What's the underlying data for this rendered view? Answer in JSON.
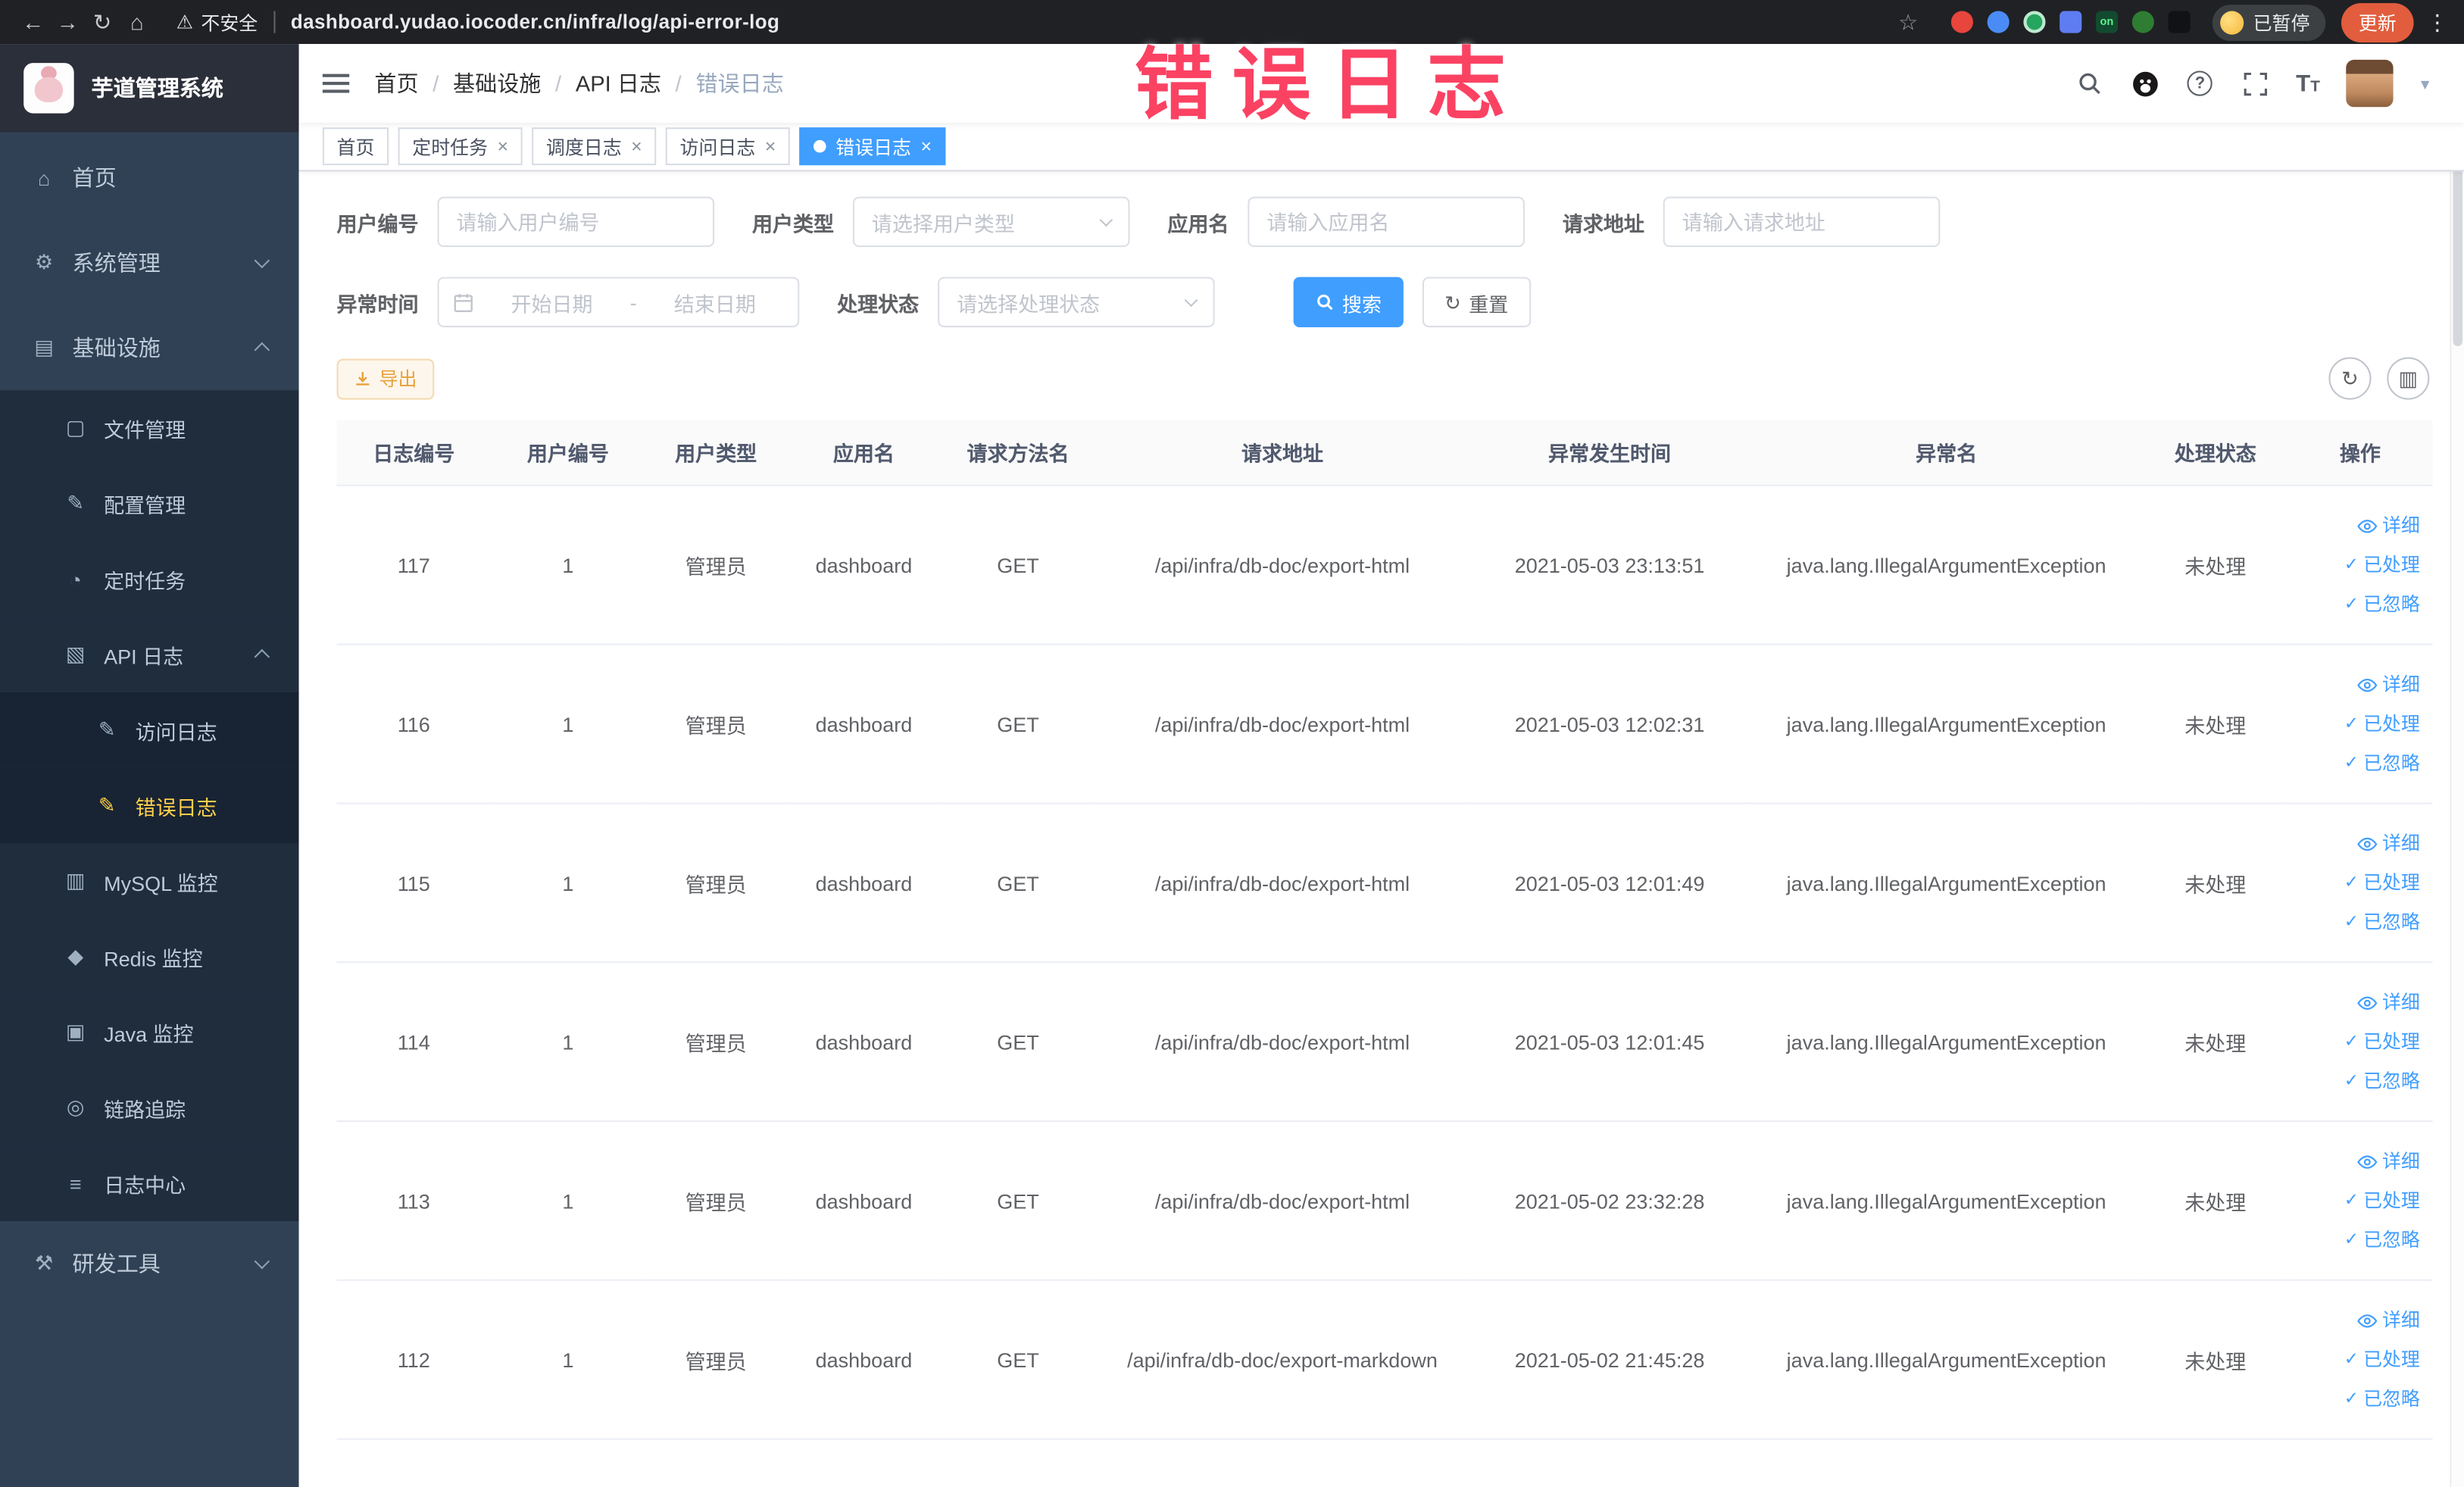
{
  "browser": {
    "security_label": "不安全",
    "url": "dashboard.yudao.iocoder.cn/infra/log/api-error-log",
    "extension_on_badge": "on",
    "paused_badge": "已暂停",
    "update_button": "更新"
  },
  "annotation": "错误日志",
  "sidebar": {
    "logo_title": "芋道管理系统",
    "items": [
      {
        "label": "首页"
      },
      {
        "label": "系统管理"
      },
      {
        "label": "基础设施"
      },
      {
        "label": "文件管理"
      },
      {
        "label": "配置管理"
      },
      {
        "label": "定时任务"
      },
      {
        "label": "API 日志"
      },
      {
        "label": "访问日志"
      },
      {
        "label": "错误日志"
      },
      {
        "label": "MySQL 监控"
      },
      {
        "label": "Redis 监控"
      },
      {
        "label": "Java 监控"
      },
      {
        "label": "链路追踪"
      },
      {
        "label": "日志中心"
      },
      {
        "label": "研发工具"
      }
    ]
  },
  "breadcrumb": {
    "items": [
      "首页",
      "基础设施",
      "API 日志",
      "错误日志"
    ],
    "separator": "/"
  },
  "tabs": [
    {
      "label": "首页"
    },
    {
      "label": "定时任务"
    },
    {
      "label": "调度日志"
    },
    {
      "label": "访问日志"
    },
    {
      "label": "错误日志"
    }
  ],
  "filters": {
    "user_id_label": "用户编号",
    "user_id_placeholder": "请输入用户编号",
    "user_type_label": "用户类型",
    "user_type_placeholder": "请选择用户类型",
    "app_name_label": "应用名",
    "app_name_placeholder": "请输入应用名",
    "request_url_label": "请求地址",
    "request_url_placeholder": "请输入请求地址",
    "time_label": "异常时间",
    "time_start_placeholder": "开始日期",
    "time_separator": "-",
    "time_end_placeholder": "结束日期",
    "status_label": "处理状态",
    "status_placeholder": "请选择处理状态",
    "search_button": "搜索",
    "reset_button": "重置"
  },
  "toolbar": {
    "export_button": "导出"
  },
  "table": {
    "headers": [
      "日志编号",
      "用户编号",
      "用户类型",
      "应用名",
      "请求方法名",
      "请求地址",
      "异常发生时间",
      "异常名",
      "处理状态",
      "操作"
    ],
    "action_detail": "详细",
    "action_processed": "已处理",
    "action_ignored": "已忽略",
    "rows": [
      {
        "id": "117",
        "user_id": "1",
        "user_type": "管理员",
        "app_name": "dashboard",
        "method": "GET",
        "url": "/api/infra/db-doc/export-html",
        "time": "2021-05-03 23:13:51",
        "exception": "java.lang.IllegalArgumentException",
        "status": "未处理"
      },
      {
        "id": "116",
        "user_id": "1",
        "user_type": "管理员",
        "app_name": "dashboard",
        "method": "GET",
        "url": "/api/infra/db-doc/export-html",
        "time": "2021-05-03 12:02:31",
        "exception": "java.lang.IllegalArgumentException",
        "status": "未处理"
      },
      {
        "id": "115",
        "user_id": "1",
        "user_type": "管理员",
        "app_name": "dashboard",
        "method": "GET",
        "url": "/api/infra/db-doc/export-html",
        "time": "2021-05-03 12:01:49",
        "exception": "java.lang.IllegalArgumentException",
        "status": "未处理"
      },
      {
        "id": "114",
        "user_id": "1",
        "user_type": "管理员",
        "app_name": "dashboard",
        "method": "GET",
        "url": "/api/infra/db-doc/export-html",
        "time": "2021-05-03 12:01:45",
        "exception": "java.lang.IllegalArgumentException",
        "status": "未处理"
      },
      {
        "id": "113",
        "user_id": "1",
        "user_type": "管理员",
        "app_name": "dashboard",
        "method": "GET",
        "url": "/api/infra/db-doc/export-html",
        "time": "2021-05-02 23:32:28",
        "exception": "java.lang.IllegalArgumentException",
        "status": "未处理"
      },
      {
        "id": "112",
        "user_id": "1",
        "user_type": "管理员",
        "app_name": "dashboard",
        "method": "GET",
        "url": "/api/infra/db-doc/export-markdown",
        "time": "2021-05-02 21:45:28",
        "exception": "java.lang.IllegalArgumentException",
        "status": "未处理"
      }
    ]
  },
  "icons": {
    "back": "←",
    "forward": "→",
    "reload": "↻",
    "home_nav": "⌂",
    "warning": "⚠",
    "star": "☆",
    "kebab": "⋮",
    "caret_down": "▾",
    "close": "×",
    "check": "✓",
    "refresh": "↻",
    "columns": "▥",
    "question": "?",
    "font_size": "T",
    "home": "⌂",
    "gear": "⚙",
    "infra": "▤",
    "file": "▢",
    "edit": "✎",
    "clock": "◔",
    "api": "▧",
    "mysql": "▥",
    "redis": "◆",
    "java": "▣",
    "eye": "◎",
    "list": "≡",
    "tools": "⚒"
  }
}
